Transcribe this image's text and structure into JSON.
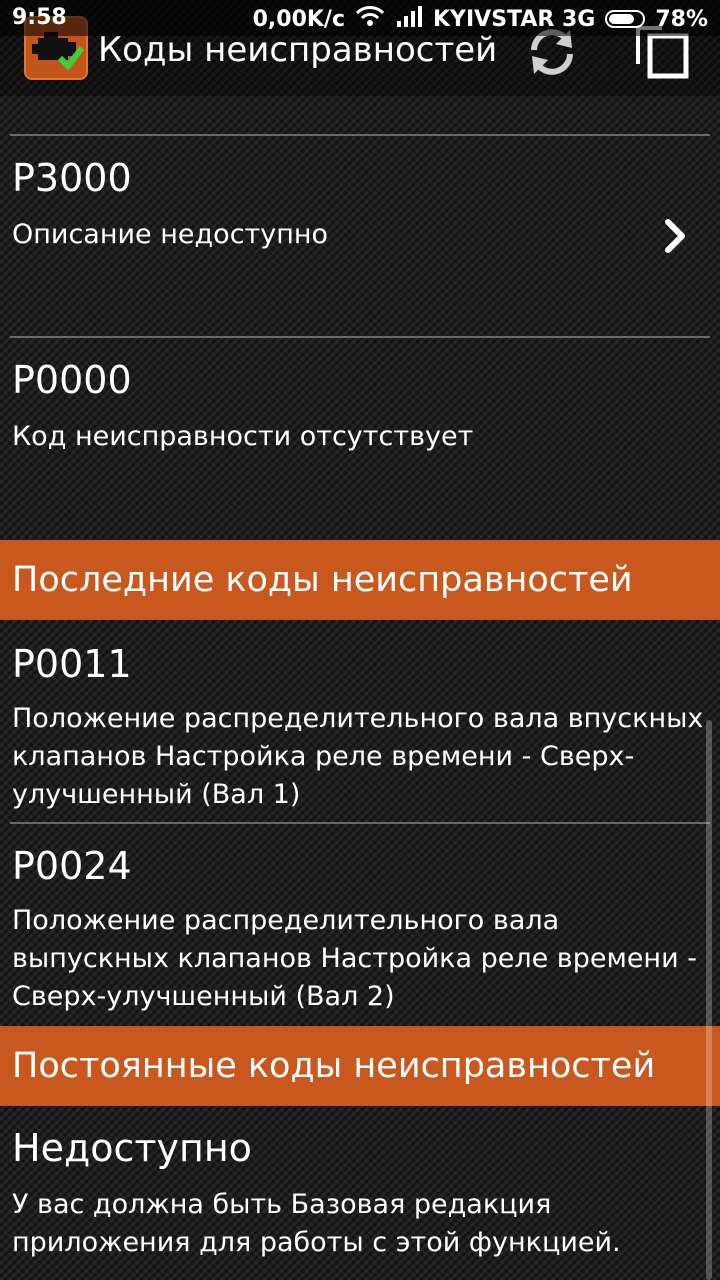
{
  "status_bar": {
    "time": "9:58",
    "speed": "0,00K/c",
    "carrier": "KYIVSTAR 3G",
    "battery": "78%",
    "battery_level": 0.78
  },
  "app_bar": {
    "title": "Коды неисправностей",
    "icon": "engine-check-icon",
    "actions": [
      "refresh-icon",
      "copy-icon"
    ]
  },
  "current_codes": [
    {
      "code": "P3000",
      "description": "Описание недоступно",
      "has_details": true
    },
    {
      "code": "P0000",
      "description": "Код неисправности отсутствует",
      "has_details": false
    }
  ],
  "last_codes_section": {
    "title": "Последние коды неисправностей",
    "items": [
      {
        "code": "P0011",
        "description": "Положение распределительного вала впускных клапанов Настройка реле времени - Сверх-улучшенный (Вал 1)"
      },
      {
        "code": "P0024",
        "description": "Положение распределительного вала выпускных клапанов Настройка реле времени - Сверх-улучшенный (Вал 2)"
      }
    ]
  },
  "permanent_codes_section": {
    "title": "Постоянные коды неисправностей",
    "status": "Недоступно",
    "message": "У вас должна быть Базовая редакция приложения для работы с этой функцией."
  },
  "colors": {
    "accent": "#c8581d",
    "background": "#1c1c1c",
    "divider": "#6a6a6a"
  }
}
